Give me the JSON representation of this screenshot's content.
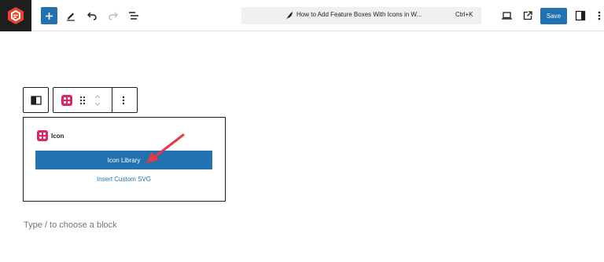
{
  "topbar": {
    "logo_icon": "site-logo-icon",
    "add_icon": "plus-icon",
    "tools_icon": "pencil-icon",
    "undo_icon": "undo-icon",
    "redo_icon": "redo-icon",
    "outline_icon": "document-overview-icon",
    "command": {
      "icon": "feather-icon",
      "title": "How to Add Feature Boxes With Icons in W...",
      "shortcut": "Ctrl+K"
    },
    "preview_icon": "laptop-icon",
    "external_icon": "external-link-icon",
    "save_label": "Save",
    "settings_icon": "sidebar-toggle-icon",
    "more_icon": "more-vertical-icon",
    "accent_color": "#2271b1"
  },
  "block_toolbar": {
    "parent_icon": "columns-icon",
    "block_icon": "icon-block-icon",
    "drag_icon": "drag-handle-icon",
    "move_icon": "chevron-up-down-icon",
    "options_icon": "more-vertical-icon"
  },
  "block": {
    "label": "Icon",
    "primary_button": "Icon Library",
    "secondary_link": "Insert Custom SVG",
    "brand_color": "#e0245e"
  },
  "annotation": {
    "arrow_color": "#e63946"
  },
  "editor": {
    "placeholder": "Type / to choose a block"
  }
}
